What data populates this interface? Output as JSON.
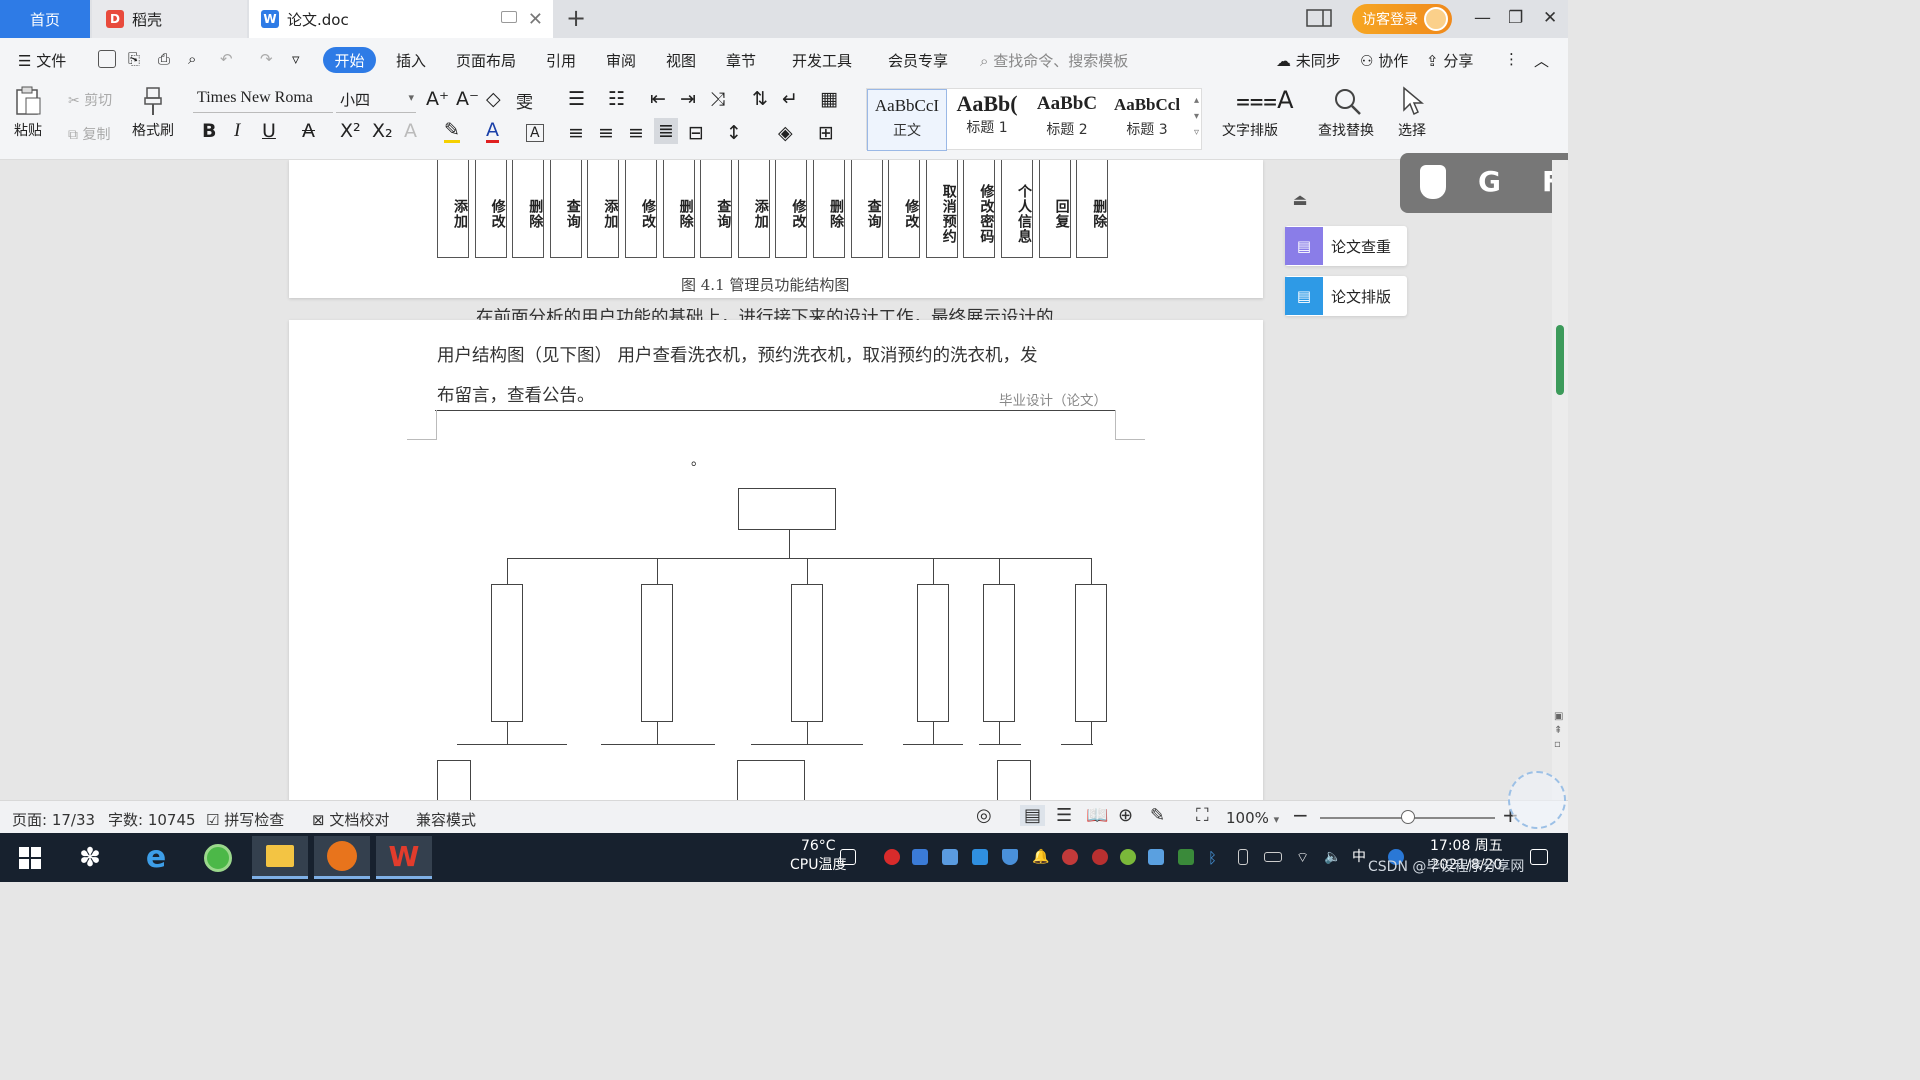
{
  "tabs": {
    "home": "首页",
    "daoke": "稻壳",
    "doc": "论文.doc"
  },
  "title_right": {
    "login": "访客登录"
  },
  "menu": {
    "file": "文件",
    "items": [
      "开始",
      "插入",
      "页面布局",
      "引用",
      "审阅",
      "视图",
      "章节",
      "开发工具",
      "会员专享"
    ],
    "search_placeholder": "查找命令、搜索模板",
    "sync": "未同步",
    "collab": "协作",
    "share": "分享"
  },
  "ribbon": {
    "paste": "粘贴",
    "cut": "剪切",
    "copy": "复制",
    "format_painter": "格式刷",
    "font_name": "Times New Roma",
    "font_size": "小四",
    "styles": [
      {
        "sample": "AaBbCcI",
        "name": "正文"
      },
      {
        "sample": "AaBb(",
        "name": "标题 1"
      },
      {
        "sample": "AaBbC",
        "name": "标题 2"
      },
      {
        "sample": "AaBbCcl",
        "name": "标题 3"
      }
    ],
    "text_layout": "文字排版",
    "find_replace": "查找替换",
    "select": "选择"
  },
  "document": {
    "function_boxes": [
      "添加",
      "修改",
      "删除",
      "查询",
      "添加",
      "修改",
      "删除",
      "查询",
      "添加",
      "修改",
      "删除",
      "查询",
      "修改",
      "取消预约",
      "修改密码",
      "个人信息",
      "回复",
      "删除"
    ],
    "figure_caption": "图 4.1  管理员功能结构图",
    "paragraph_line1": "在前面分析的用户功能的基础上，进行接下来的设计工作，最终展示设计的",
    "paragraph_line2": "用户结构图（见下图）    用户查看洗衣机，预约洗衣机，取消预约的洗衣机，发",
    "paragraph_line3": "布留言，查看公告。",
    "header_text": "毕业设计（论文）",
    "dot": "。"
  },
  "side_panel": {
    "check": "论文查重",
    "layout": "论文排版",
    "float_letters": [
      "G",
      "F"
    ]
  },
  "status": {
    "page": "页面: 17/33",
    "words": "字数: 10745",
    "spell": "拼写检查",
    "proof": "文档校对",
    "compat": "兼容模式",
    "zoom": "100%",
    "zoom_level": 0.5
  },
  "taskbar": {
    "temp": "76°C",
    "cpu_label": "CPU温度",
    "time": "17:08 周五",
    "date": "2021/8/20",
    "ime": "中",
    "watermark": "CSDN @毕设程序分享网"
  }
}
